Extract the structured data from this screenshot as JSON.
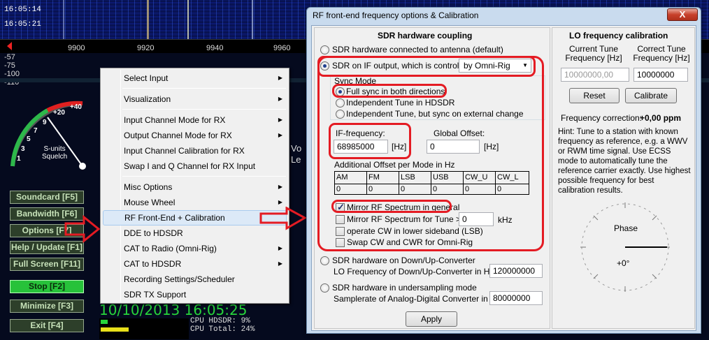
{
  "app": {
    "waterfall_times": [
      "16:05:14",
      "16:05:21"
    ],
    "freq_ticks": [
      "9900",
      "9920",
      "9940",
      "9960"
    ],
    "db_labels": [
      "-57",
      "-75",
      "-100",
      "-110"
    ],
    "smeter_scale": [
      "+40",
      "+20",
      "9",
      "7",
      "5",
      "3",
      "1"
    ],
    "smeter_caption": [
      "S-units",
      "Squelch"
    ],
    "left_buttons": [
      "Soundcard [F5]",
      "Bandwidth [F6]",
      "Options [F7]",
      "Help / Update [F1]",
      "Full Screen [F11]",
      "Stop [F2]",
      "Minimize [F3]",
      "Exit [F4]"
    ],
    "datetime": "10/10/2013 16:05:25",
    "cpu_hdsdr": "CPU HDSDR: 9%",
    "cpu_total": "CPU Total: 24%",
    "bg_labels": [
      "Vo",
      "Le"
    ],
    "colors": {
      "accent_red": "#e41b23",
      "green_display": "#27d43b"
    }
  },
  "menu": {
    "items": [
      {
        "label": "Select Input",
        "submenu": true
      },
      {
        "label": "Visualization",
        "submenu": true
      },
      {
        "label": "Input Channel Mode for RX",
        "submenu": true
      },
      {
        "label": "Output Channel Mode for RX",
        "submenu": true
      },
      {
        "label": "Input Channel Calibration for RX",
        "submenu": false
      },
      {
        "label": "Swap I and Q Channel for RX Input",
        "submenu": false
      },
      {
        "label": "Misc Options",
        "submenu": true
      },
      {
        "label": "Mouse Wheel",
        "submenu": true
      },
      {
        "label": "RF Front-End + Calibration",
        "submenu": false
      },
      {
        "label": "DDE to HDSDR",
        "submenu": false
      },
      {
        "label": "CAT to Radio (Omni-Rig)",
        "submenu": true
      },
      {
        "label": "CAT to HDSDR",
        "submenu": true
      },
      {
        "label": "Recording Settings/Scheduler",
        "submenu": false
      },
      {
        "label": "SDR TX Support",
        "submenu": false
      }
    ]
  },
  "dialog": {
    "title": "RF front-end frequency options & Calibration",
    "close_label": "X",
    "coupling": {
      "title": "SDR hardware coupling",
      "opt_antenna": "SDR hardware connected to antenna (default)",
      "opt_if": "SDR on IF output, which is controlled",
      "controller": "by Omni-Rig",
      "sync_mode_title": "Sync Mode",
      "sync_full": "Full sync in both directions",
      "sync_indep": "Independent Tune in HDSDR",
      "sync_indep_ext": "Independent Tune, but sync on external change",
      "if_freq_label": "IF-frequency:",
      "if_freq_value": "68985000",
      "if_freq_unit": "[Hz]",
      "global_offset_label": "Global Offset:",
      "global_offset_value": "0",
      "global_offset_unit": "[Hz]",
      "add_offset_label": "Additional Offset per Mode in Hz",
      "modes": [
        "AM",
        "FM",
        "LSB",
        "USB",
        "CW_U",
        "CW_L"
      ],
      "mode_values": [
        "0",
        "0",
        "0",
        "0",
        "0",
        "0"
      ],
      "mirror_general": "Mirror RF Spectrum in general",
      "mirror_tune": "Mirror RF Spectrum for Tune >=",
      "mirror_tune_value": "0",
      "mirror_tune_unit": "kHz",
      "cw_lsb": "operate CW in lower sideband (LSB)",
      "swap_cw": "Swap CW and CWR for Omni-Rig",
      "opt_converter": "SDR hardware on Down/Up-Converter",
      "converter_lo_label": "LO Frequency of  Down/Up-Converter in Hz:",
      "converter_lo_value": "120000000",
      "opt_undersampling": "SDR hardware in undersampling mode",
      "adc_label": "Samplerate of Analog-Digital Converter in Hz:",
      "adc_value": "80000000",
      "apply_label": "Apply"
    },
    "lo": {
      "title": "LO frequency calibration",
      "current_label": "Current Tune Frequency [Hz]",
      "correct_label": "Correct Tune Frequency [Hz]",
      "current_value": "10000000,00",
      "correct_value": "10000000",
      "reset_label": "Reset",
      "calibrate_label": "Calibrate",
      "correction_label": "Frequency correction:",
      "correction_value": "+0,00 ppm",
      "hint": "Hint: Tune to a station with known frequency as reference, e.g. a WWV or RWM time signal. Use ECSS mode to automatically tune the reference carrier exactly. Use highest possible frequency for best calibration results.",
      "phase_label": "Phase",
      "phase_value": "+0°"
    }
  }
}
